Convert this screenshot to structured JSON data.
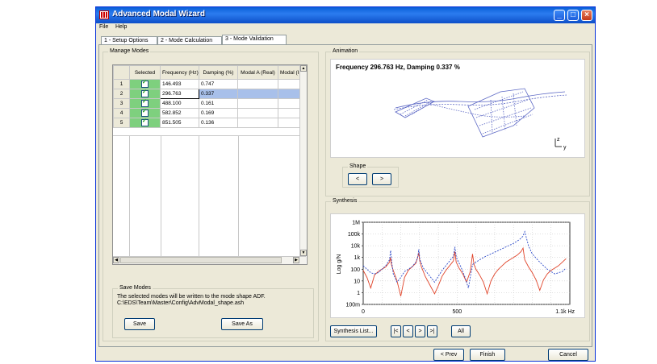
{
  "window": {
    "title": "Advanced Modal Wizard",
    "buttons": {
      "minimize": "_",
      "maximize": "□",
      "close": "×"
    }
  },
  "menu": [
    "File",
    "Help"
  ],
  "tabs": [
    "1 - Setup Options",
    "2 - Mode Calculation",
    "3 - Mode Validation"
  ],
  "active_tab": 2,
  "manage_modes": {
    "label": "Manage Modes",
    "columns": [
      "",
      "Selected",
      "Frequency (Hz)",
      "Damping (%)",
      "Modal A (Real)",
      "Modal (Imagin"
    ],
    "rows": [
      {
        "n": "1",
        "frequency": "146.493",
        "damping": "0.747",
        "selected": true
      },
      {
        "n": "2",
        "frequency": "296.763",
        "damping": "0.337",
        "selected": true
      },
      {
        "n": "3",
        "frequency": "488.100",
        "damping": "0.161",
        "selected": true
      },
      {
        "n": "4",
        "frequency": "582.852",
        "damping": "0.169",
        "selected": true
      },
      {
        "n": "5",
        "frequency": "851.505",
        "damping": "0.136",
        "selected": true
      }
    ],
    "highlighted_row": 2
  },
  "save_modes": {
    "label": "Save Modes",
    "line1": "The selected modes will be written to the mode shape ADF.",
    "line2": "C:\\EDS\\Team\\Master\\Config\\AdvModal_shape.ash",
    "save": "Save",
    "save_as": "Save As"
  },
  "animation": {
    "label": "Animation",
    "caption": "Frequency 296.763 Hz, Damping 0.337 %",
    "axis_z": "z",
    "axis_y": "y",
    "shape_label": "Shape",
    "prev": "<",
    "next": ">"
  },
  "synthesis": {
    "label": "Synthesis",
    "ylabel": "Log g/N",
    "yticks": [
      "1M",
      "100k",
      "10k",
      "1k",
      "100",
      "10",
      "1",
      "100m"
    ],
    "xticks": [
      "0",
      "500",
      "1.1k Hz"
    ],
    "list_button": "Synthesis List...",
    "nav": [
      "|<",
      "<",
      ">",
      ">|"
    ],
    "all": "All",
    "colors": {
      "measured": "#e0442a",
      "synthesized": "#2a48c8"
    }
  },
  "chart_data": {
    "type": "line",
    "title": "",
    "xlabel": "",
    "ylabel": "Log g/N",
    "xlim": [
      0,
      1100
    ],
    "ylim_log10": [
      -1,
      6
    ],
    "log_y": true,
    "grid": true,
    "series": [
      {
        "color": "#e0442a",
        "style": "solid",
        "x": [
          0,
          20,
          40,
          60,
          80,
          100,
          120,
          140,
          145,
          150,
          160,
          180,
          200,
          220,
          240,
          260,
          280,
          290,
          296,
          300,
          310,
          330,
          350,
          380,
          400,
          420,
          440,
          460,
          480,
          488,
          495,
          510,
          530,
          550,
          570,
          582,
          590,
          600,
          620,
          640,
          660,
          680,
          700,
          720,
          740,
          760,
          780,
          800,
          820,
          840,
          851,
          860,
          880,
          900,
          920,
          940,
          960,
          980,
          1000,
          1020,
          1040,
          1060,
          1080
        ],
        "y_log10": [
          1.9,
          1.3,
          0.4,
          1.5,
          1.8,
          2.0,
          2.2,
          2.6,
          3.0,
          2.4,
          1.9,
          1.0,
          -0.3,
          1.3,
          1.9,
          2.2,
          2.5,
          3.0,
          3.4,
          2.8,
          2.2,
          1.4,
          0.8,
          -0.1,
          0.6,
          1.4,
          1.9,
          2.3,
          2.7,
          3.5,
          2.6,
          2.1,
          1.6,
          0.9,
          1.8,
          3.3,
          2.4,
          2.0,
          1.5,
          0.9,
          -0.1,
          1.0,
          1.6,
          2.0,
          2.3,
          2.6,
          2.8,
          3.0,
          3.2,
          3.5,
          3.8,
          2.8,
          2.2,
          1.7,
          1.1,
          0.2,
          1.1,
          1.6,
          1.9,
          2.1,
          2.3,
          2.6,
          2.9
        ]
      },
      {
        "color": "#2a48c8",
        "style": "dotted",
        "x": [
          0,
          20,
          40,
          60,
          80,
          100,
          120,
          140,
          146,
          152,
          160,
          180,
          200,
          220,
          240,
          260,
          280,
          290,
          296,
          302,
          320,
          350,
          380,
          400,
          420,
          440,
          460,
          480,
          488,
          496,
          520,
          540,
          560,
          582,
          600,
          640,
          680,
          720,
          760,
          800,
          830,
          850,
          860,
          870,
          880,
          900,
          940,
          980,
          1020,
          1060,
          1080
        ],
        "y_log10": [
          2.3,
          2.0,
          1.7,
          1.6,
          1.7,
          2.0,
          2.3,
          2.8,
          3.6,
          2.6,
          1.6,
          0.9,
          1.3,
          1.8,
          2.0,
          2.2,
          2.6,
          3.0,
          3.7,
          2.8,
          2.1,
          1.5,
          0.9,
          1.4,
          1.9,
          2.3,
          2.7,
          3.1,
          3.9,
          3.0,
          2.2,
          1.4,
          0.4,
          2.4,
          2.6,
          3.0,
          3.3,
          3.6,
          3.9,
          4.2,
          4.5,
          4.8,
          5.2,
          4.6,
          4.0,
          3.3,
          2.6,
          2.0,
          1.6,
          1.8,
          2.1
        ]
      }
    ]
  },
  "footer": {
    "prev": "< Prev",
    "finish": "Finish",
    "cancel": "Cancel"
  }
}
